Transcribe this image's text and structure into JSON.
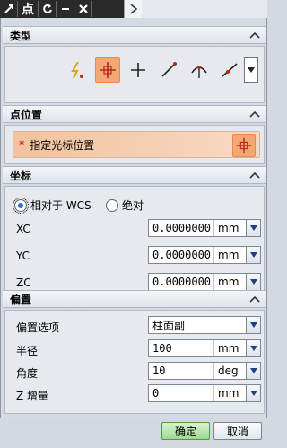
{
  "titlebar": {
    "title": "点",
    "buttons": [
      "reset",
      "minimize",
      "close"
    ]
  },
  "sections": {
    "type": {
      "label": "类型",
      "selected_icon": "point-cursor-location-icon"
    },
    "point_position": {
      "label": "点位置",
      "instruction": "指定光标位置",
      "required_mark": "*"
    },
    "coordinates": {
      "label": "坐标",
      "radio_options": [
        "相对于 WCS",
        "绝对"
      ],
      "selected": "相对于 WCS",
      "fields": [
        {
          "label": "XC",
          "value": "0.0000000",
          "unit": "mm"
        },
        {
          "label": "YC",
          "value": "0.0000000",
          "unit": "mm"
        },
        {
          "label": "ZC",
          "value": "0.0000000",
          "unit": "mm"
        }
      ]
    },
    "offset": {
      "label": "偏置",
      "option_label": "偏置选项",
      "option_value": "柱面副",
      "fields": [
        {
          "label": "半径",
          "value": "100",
          "unit": "mm"
        },
        {
          "label": "角度",
          "value": "10",
          "unit": "deg"
        },
        {
          "label": "Z 增量",
          "value": "0",
          "unit": "mm"
        }
      ]
    }
  },
  "footer": {
    "ok": "确定",
    "cancel": "取消"
  },
  "colors": {
    "accent_orange": "#f0a874",
    "ok_green": "#9ed990"
  }
}
